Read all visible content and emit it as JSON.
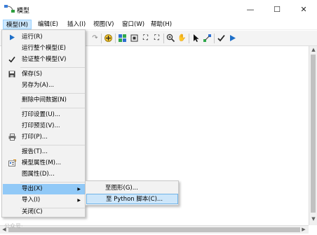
{
  "window": {
    "title": "模型",
    "minimize": "—",
    "maximize": "☐",
    "close": "✕"
  },
  "menubar": [
    "模型(M)",
    "编辑(E)",
    "插入(I)",
    "视图(V)",
    "窗口(W)",
    "帮助(H)"
  ],
  "dropdown": {
    "items": [
      "运行(R)",
      "运行整个模型(E)",
      "验证整个模型(V)",
      "保存(S)",
      "另存为(A)...",
      "删除中间数据(N)",
      "打印设置(U)...",
      "打印预览(V)...",
      "打印(P)...",
      "报告(T)...",
      "模型属性(M)...",
      "图属性(D)...",
      "导出(X)",
      "导入(I)",
      "关闭(C)"
    ]
  },
  "submenu": {
    "items": [
      "至图形(G)...",
      "至 Python 脚本(C)..."
    ]
  },
  "watermark": "公众号·",
  "colors": {
    "menu_highlight": "#91c9f7",
    "submenu_highlight": "#cde6fa",
    "run_arrow": "#1e6fc8"
  }
}
